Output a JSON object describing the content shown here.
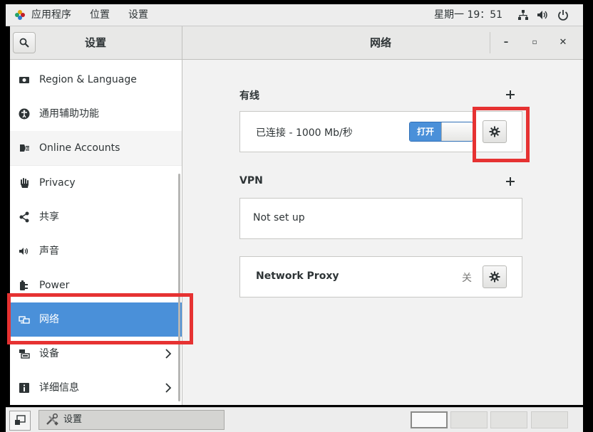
{
  "topbar": {
    "apps_menu": "应用程序",
    "places_menu": "位置",
    "settings_menu": "设置",
    "clock": "星期一 19：51"
  },
  "headerbar": {
    "sidebar_title": "设置",
    "content_title": "网络",
    "minimize": "–",
    "maximize": "▫",
    "close": "✕"
  },
  "sidebar": {
    "items": [
      {
        "label": "Region & Language",
        "icon": "flag-icon"
      },
      {
        "label": "通用辅助功能",
        "icon": "accessibility-icon"
      },
      {
        "label": "Online Accounts",
        "icon": "online-accounts-icon"
      },
      {
        "label": "Privacy",
        "icon": "hand-icon"
      },
      {
        "label": "共享",
        "icon": "share-icon"
      },
      {
        "label": "声音",
        "icon": "speaker-icon"
      },
      {
        "label": "Power",
        "icon": "power-plug-icon"
      },
      {
        "label": "网络",
        "icon": "network-icon",
        "selected": true
      },
      {
        "label": "设备",
        "icon": "devices-icon",
        "has_submenu": true
      },
      {
        "label": "详细信息",
        "icon": "info-icon",
        "has_submenu": true
      }
    ]
  },
  "wired": {
    "title": "有线",
    "status": "已连接 - 1000 Mb/秒",
    "toggle_label": "打开",
    "toggle_on": true
  },
  "vpn": {
    "title": "VPN",
    "status": "Not set up"
  },
  "proxy": {
    "title": "Network Proxy",
    "status": "关"
  },
  "taskbar": {
    "task_label": "设置",
    "workspaces": 4,
    "active_workspace": 1
  },
  "colors": {
    "accent": "#4a90d9",
    "highlight": "#e63232"
  }
}
